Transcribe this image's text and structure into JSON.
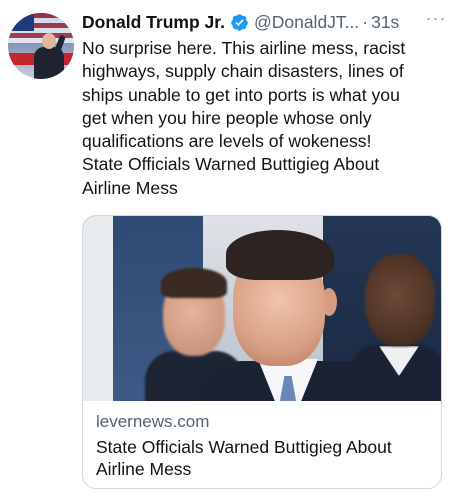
{
  "tweet": {
    "author_name": "Donald Trump Jr.",
    "handle": "@DonaldJT...",
    "separator": "·",
    "time": "31s",
    "more_label": "···",
    "body_lines": [
      "No surprise here. This airline mess, racist",
      "highways, supply chain disasters, lines of",
      "ships unable to get into ports is what you",
      "get when you hire people whose only",
      "qualifications are levels of wokeness!",
      "State Officials Warned Buttigieg About",
      "Airline Mess"
    ]
  },
  "card": {
    "domain": "levernews.com",
    "title_lines": [
      "State Officials Warned Buttigieg About",
      "Airline Mess"
    ]
  },
  "colors": {
    "verified": "#1d9bf0",
    "secondary_text": "#536471",
    "primary_text": "#0f1419",
    "border": "#cfd9de"
  },
  "icons": {
    "verified": "verified-badge-icon",
    "more": "more-options-icon"
  }
}
